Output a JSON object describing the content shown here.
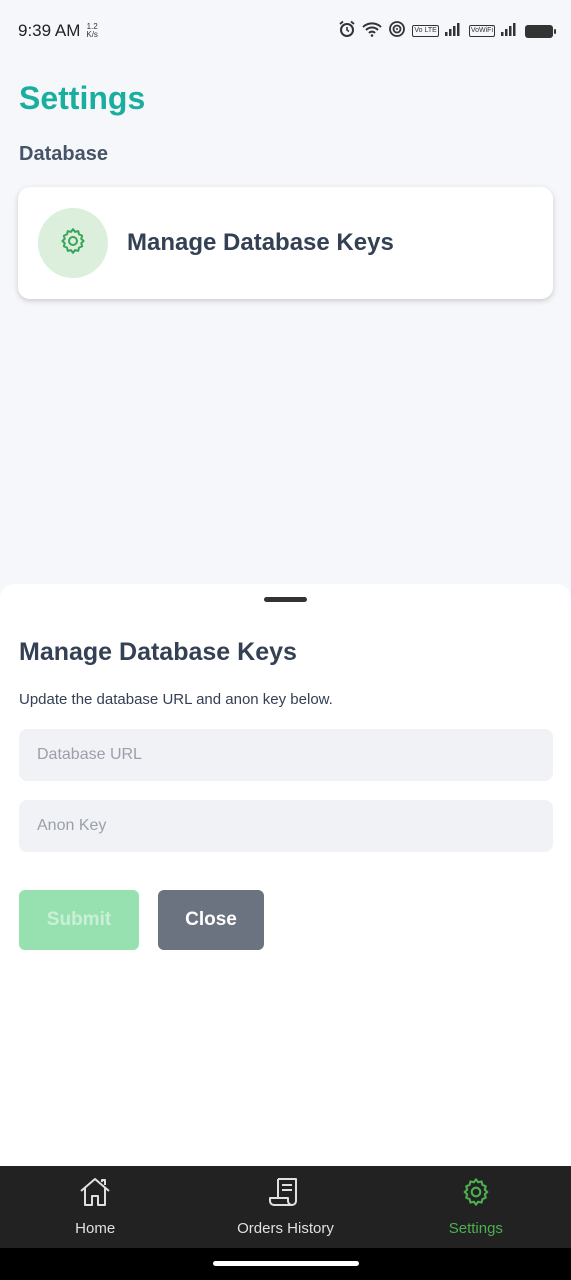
{
  "status_bar": {
    "time": "9:39 AM",
    "speed_top": "1.2",
    "speed_bottom": "K/s",
    "vo_lte": "Vo LTE",
    "vowifi": "VoWiFi",
    "icons": [
      "alarm-icon",
      "wifi-icon",
      "hotspot-icon",
      "signal-icon",
      "battery-icon"
    ]
  },
  "page": {
    "title": "Settings",
    "section": "Database"
  },
  "card": {
    "label": "Manage Database Keys",
    "icon": "gear-icon"
  },
  "sheet": {
    "title": "Manage Database Keys",
    "description": "Update the database URL and anon key below.",
    "url_placeholder": "Database URL",
    "url_value": "",
    "key_placeholder": "Anon Key",
    "key_value": "",
    "submit_label": "Submit",
    "close_label": "Close"
  },
  "nav": {
    "items": [
      {
        "label": "Home",
        "icon": "home-icon",
        "active": false
      },
      {
        "label": "Orders History",
        "icon": "receipt-icon",
        "active": false
      },
      {
        "label": "Settings",
        "icon": "gear-icon",
        "active": true
      }
    ]
  },
  "colors": {
    "accent": "#1aae9f",
    "nav_active": "#4caf50",
    "submit_disabled": "#97e1b1",
    "close_button": "#6b7280",
    "nav_bg": "#222222"
  }
}
